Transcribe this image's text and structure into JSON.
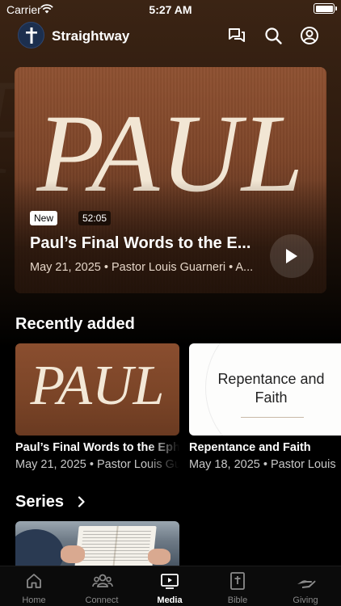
{
  "status_bar": {
    "carrier": "Carrier",
    "time": "5:27 AM"
  },
  "header": {
    "title": "Straightway",
    "icons": [
      "chat-icon",
      "search-icon",
      "account-icon"
    ]
  },
  "hero": {
    "art_text": "PAUL",
    "badge_new": "New",
    "duration": "52:05",
    "title": "Paul’s Final Words to the E...",
    "meta": "May 21, 2025 • Pastor Louis Guarneri • A..."
  },
  "recently_added": {
    "title": "Recently added",
    "items": [
      {
        "art_text": "PAUL",
        "title": "Paul’s Final Words to the Eph",
        "meta": "May 21, 2025 • Pastor Louis Gu"
      },
      {
        "art_line1": "Repentance and",
        "art_line2": "Faith",
        "title": "Repentance and Faith",
        "meta": "May 18, 2025 • Pastor Louis"
      }
    ]
  },
  "series": {
    "title": "Series"
  },
  "tab_bar": {
    "tabs": [
      {
        "label": "Home",
        "icon": "home-icon"
      },
      {
        "label": "Connect",
        "icon": "people-icon"
      },
      {
        "label": "Media",
        "icon": "play-screen-icon",
        "active": true
      },
      {
        "label": "Bible",
        "icon": "bible-icon"
      },
      {
        "label": "Giving",
        "icon": "giving-hand-icon"
      }
    ]
  },
  "colors": {
    "background": "#000000",
    "hero_brown": "#7d4529",
    "logo_navy": "#1c2f4e",
    "tab_inactive": "#8a8a8a"
  }
}
